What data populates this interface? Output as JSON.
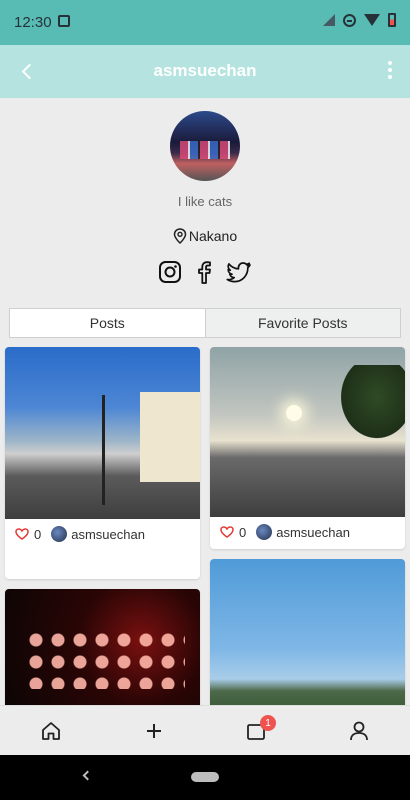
{
  "status": {
    "time": "12:30"
  },
  "header": {
    "title": "asmsuechan"
  },
  "profile": {
    "bio": "I like cats",
    "location": "Nakano"
  },
  "tabs": [
    {
      "label": "Posts"
    },
    {
      "label": "Favorite Posts"
    }
  ],
  "posts": [
    {
      "likes": "0",
      "user": "asmsuechan"
    },
    {
      "likes": "0",
      "user": "asmsuechan"
    }
  ],
  "nav": {
    "badge": "1"
  },
  "colors": {
    "status_bar": "#58bcb4",
    "top_bar": "#b4e3e0",
    "heart": "#e53935",
    "badge": "#ef5350"
  }
}
